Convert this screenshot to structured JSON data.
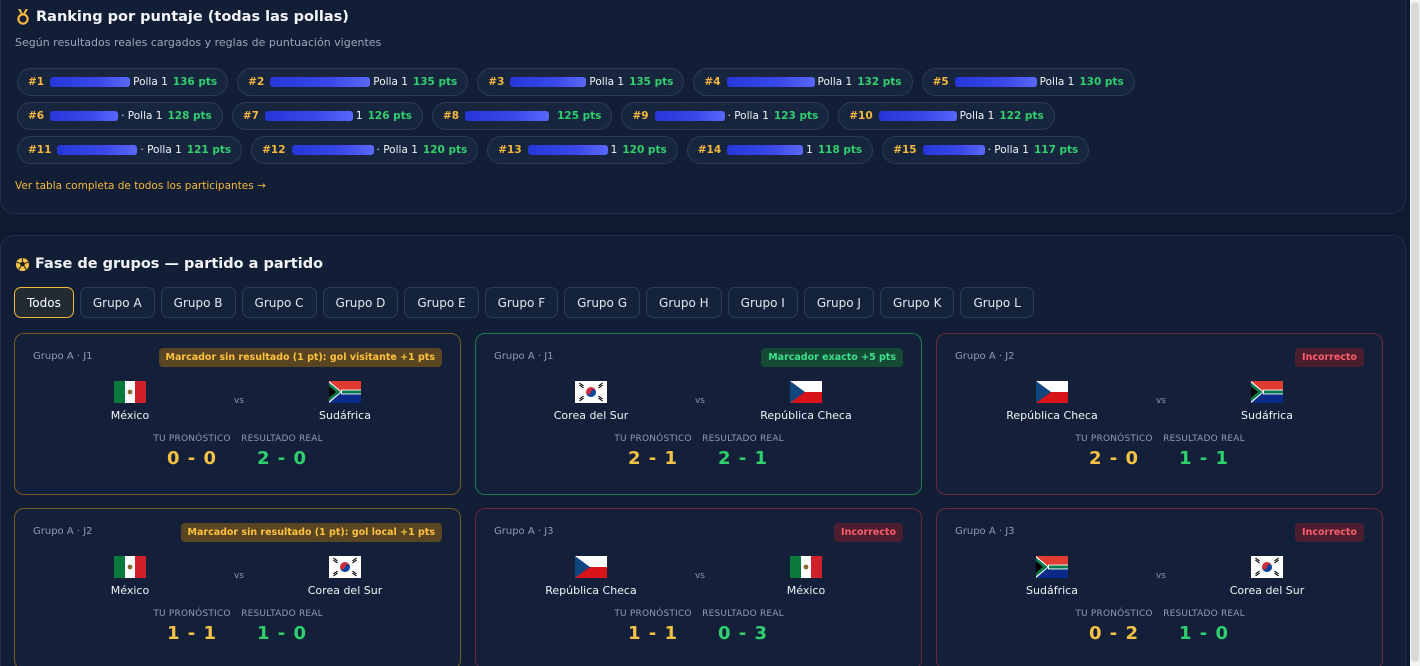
{
  "ranking": {
    "title": "Ranking por puntaje (todas las pollas)",
    "subtitle": "Según resultados reales cargados y reglas de puntuación vigentes",
    "link": "Ver tabla completa de todos los participantes →",
    "entries": [
      {
        "rank": "#1",
        "sub": "Polla 1",
        "points": "136 pts"
      },
      {
        "rank": "#2",
        "sub": "Polla 1",
        "points": "135 pts"
      },
      {
        "rank": "#3",
        "sub": "Polla 1",
        "points": "135 pts"
      },
      {
        "rank": "#4",
        "sub": "Polla 1",
        "points": "132 pts"
      },
      {
        "rank": "#5",
        "sub": "Polla 1",
        "points": "130 pts"
      },
      {
        "rank": "#6",
        "sub": "· Polla 1",
        "points": "128 pts"
      },
      {
        "rank": "#7",
        "sub": "1",
        "points": "126 pts"
      },
      {
        "rank": "#8",
        "sub": "",
        "points": "125 pts"
      },
      {
        "rank": "#9",
        "sub": "· Polla 1",
        "points": "123 pts"
      },
      {
        "rank": "#10",
        "sub": "Polla 1",
        "points": "122 pts"
      },
      {
        "rank": "#11",
        "sub": "· Polla 1",
        "points": "121 pts"
      },
      {
        "rank": "#12",
        "sub": "· Polla 1",
        "points": "120 pts"
      },
      {
        "rank": "#13",
        "sub": "1",
        "points": "120 pts"
      },
      {
        "rank": "#14",
        "sub": "1",
        "points": "118 pts"
      },
      {
        "rank": "#15",
        "sub": "· Polla 1",
        "points": "117 pts"
      }
    ]
  },
  "groups": {
    "title": "Fase de grupos — partido a partido",
    "tabs": [
      "Todos",
      "Grupo A",
      "Grupo B",
      "Grupo C",
      "Grupo D",
      "Grupo E",
      "Grupo F",
      "Grupo G",
      "Grupo H",
      "Grupo I",
      "Grupo J",
      "Grupo K",
      "Grupo L"
    ],
    "active_tab": "Todos",
    "labels": {
      "prediction": "TU PRONÓSTICO",
      "real": "RESULTADO REAL",
      "vs": "vs"
    },
    "matches": [
      {
        "group": "Grupo A · J1",
        "badge": "Marcador sin resultado (1 pt): gol visitante +1 pts",
        "status": "amber",
        "home": {
          "name": "México",
          "flag": "mexico-flag"
        },
        "away": {
          "name": "Sudáfrica",
          "flag": "south-africa-flag"
        },
        "prediction": "0 - 0",
        "real": "2 - 0"
      },
      {
        "group": "Grupo A · J1",
        "badge": "Marcador exacto +5 pts",
        "status": "green",
        "home": {
          "name": "Corea del Sur",
          "flag": "south-korea-flag"
        },
        "away": {
          "name": "República Checa",
          "flag": "czech-republic-flag"
        },
        "prediction": "2 - 1",
        "real": "2 - 1"
      },
      {
        "group": "Grupo A · J2",
        "badge": "Incorrecto",
        "status": "red",
        "home": {
          "name": "República Checa",
          "flag": "czech-republic-flag"
        },
        "away": {
          "name": "Sudáfrica",
          "flag": "south-africa-flag"
        },
        "prediction": "2 - 0",
        "real": "1 - 1"
      },
      {
        "group": "Grupo A · J2",
        "badge": "Marcador sin resultado (1 pt): gol local +1 pts",
        "status": "amber",
        "home": {
          "name": "México",
          "flag": "mexico-flag"
        },
        "away": {
          "name": "Corea del Sur",
          "flag": "south-korea-flag"
        },
        "prediction": "1 - 1",
        "real": "1 - 0"
      },
      {
        "group": "Grupo A · J3",
        "badge": "Incorrecto",
        "status": "red",
        "home": {
          "name": "República Checa",
          "flag": "czech-republic-flag"
        },
        "away": {
          "name": "México",
          "flag": "mexico-flag"
        },
        "prediction": "1 - 1",
        "real": "0 - 3"
      },
      {
        "group": "Grupo A · J3",
        "badge": "Incorrecto",
        "status": "red",
        "home": {
          "name": "Sudáfrica",
          "flag": "south-africa-flag"
        },
        "away": {
          "name": "Corea del Sur",
          "flag": "south-korea-flag"
        },
        "prediction": "0 - 2",
        "real": "1 - 0"
      }
    ]
  },
  "colors": {
    "background": "#0e1a30",
    "accent_gold": "#f4b83a",
    "points_green": "#2fd06e",
    "error_red": "#ff5c6c"
  },
  "icons": {
    "ranking": "medal-icon",
    "groups": "soccer-ball-icon"
  }
}
